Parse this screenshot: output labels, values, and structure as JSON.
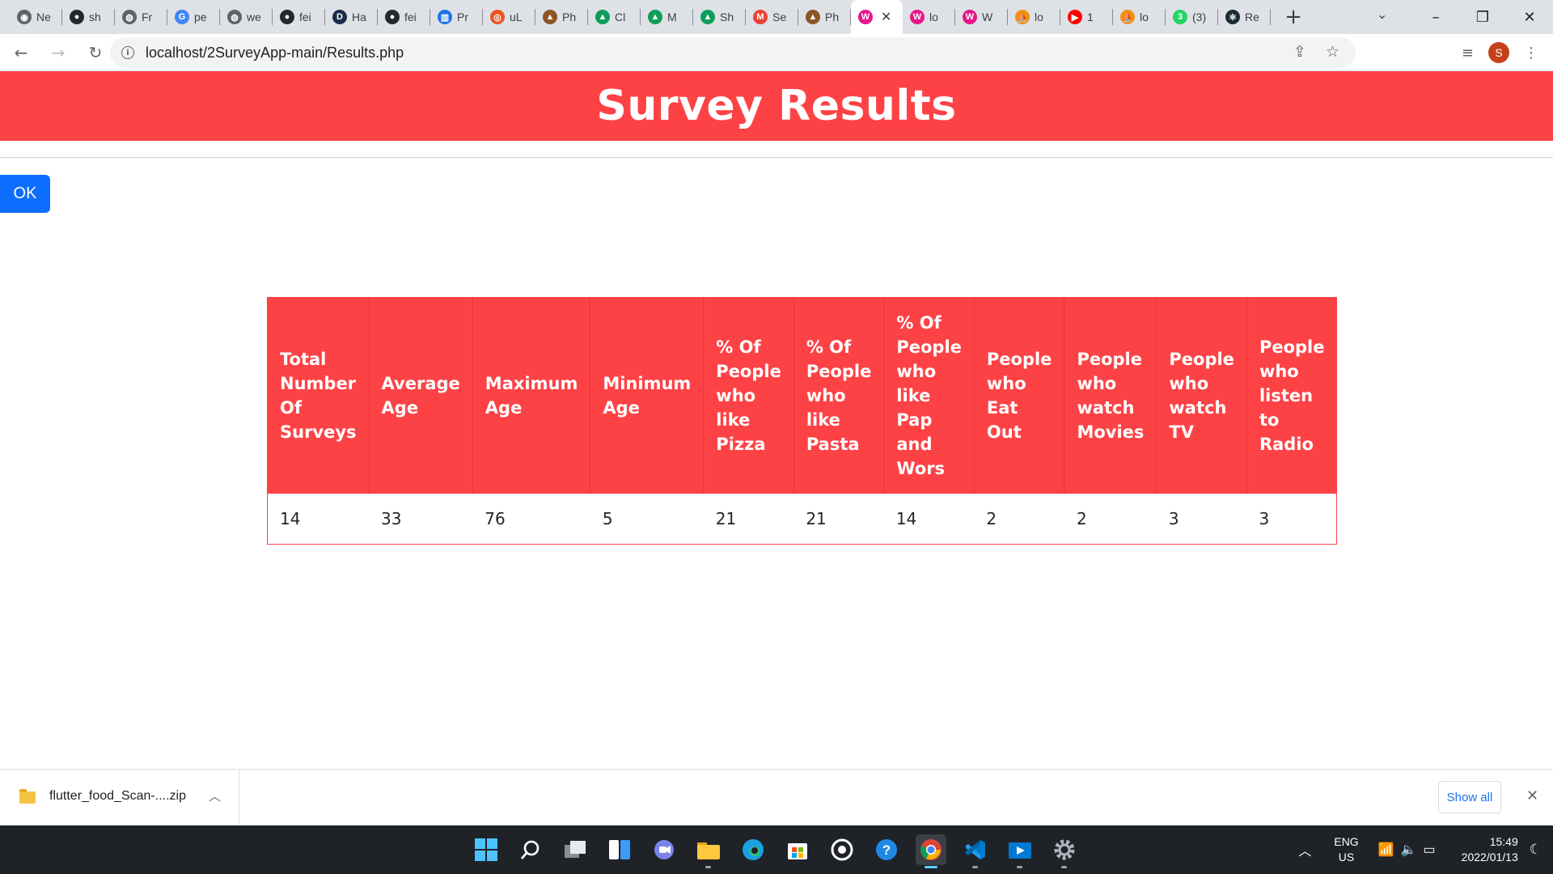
{
  "browser": {
    "tabs": [
      {
        "label": "Ne",
        "icon": "chrome-icon",
        "color": "#5f6368",
        "glyph": "◉"
      },
      {
        "label": "sh",
        "icon": "github-icon",
        "color": "#24292f",
        "glyph": "●"
      },
      {
        "label": "Fr",
        "icon": "globe-icon",
        "color": "#5f6368",
        "glyph": "◍"
      },
      {
        "label": "pe",
        "icon": "google-icon",
        "color": "#4285f4",
        "glyph": "G"
      },
      {
        "label": "we",
        "icon": "globe-icon",
        "color": "#5f6368",
        "glyph": "◍"
      },
      {
        "label": "fei",
        "icon": "github-icon",
        "color": "#24292f",
        "glyph": "●"
      },
      {
        "label": "Ha",
        "icon": "dev-icon",
        "color": "#1a2b4a",
        "glyph": "D"
      },
      {
        "label": "fei",
        "icon": "github-icon",
        "color": "#24292f",
        "glyph": "●"
      },
      {
        "label": "Pr",
        "icon": "board-icon",
        "color": "#1a73e8",
        "glyph": "▥"
      },
      {
        "label": "uL",
        "icon": "ubuntu-icon",
        "color": "#e95420",
        "glyph": "◎"
      },
      {
        "label": "Ph",
        "icon": "photo-icon",
        "color": "#8d5524",
        "glyph": "▲"
      },
      {
        "label": "Cl",
        "icon": "drive-icon",
        "color": "#0f9d58",
        "glyph": "▲"
      },
      {
        "label": "M",
        "icon": "drive-icon",
        "color": "#0f9d58",
        "glyph": "▲"
      },
      {
        "label": "Sh",
        "icon": "drive-icon",
        "color": "#0f9d58",
        "glyph": "▲"
      },
      {
        "label": "Se",
        "icon": "gmail-icon",
        "color": "#ea4335",
        "glyph": "M"
      },
      {
        "label": "Ph",
        "icon": "photo-icon",
        "color": "#8d5524",
        "glyph": "▲"
      },
      {
        "label": "",
        "icon": "wamp-icon",
        "color": "#e7168b",
        "glyph": "W",
        "active": true
      },
      {
        "label": "lo",
        "icon": "wamp-icon",
        "color": "#e7168b",
        "glyph": "W"
      },
      {
        "label": "W",
        "icon": "wamp-icon",
        "color": "#e7168b",
        "glyph": "W"
      },
      {
        "label": "lo",
        "icon": "phpmyadmin-icon",
        "color": "#f29111",
        "glyph": "⛵"
      },
      {
        "label": "1",
        "icon": "youtube-icon",
        "color": "#ff0000",
        "glyph": "▶"
      },
      {
        "label": "lo",
        "icon": "phpmyadmin-icon",
        "color": "#f29111",
        "glyph": "⛵"
      },
      {
        "label": "(3)",
        "icon": "whatsapp-icon",
        "color": "#25d366",
        "glyph": "3"
      },
      {
        "label": "Re",
        "icon": "react-icon",
        "color": "#1b2b34",
        "glyph": "⚛"
      }
    ],
    "url": "localhost/2SurveyApp-main/Results.php",
    "profile_initial": "S"
  },
  "page": {
    "heading": "Survey Results",
    "ok_button": "OK",
    "table": {
      "headers": [
        "Total Number Of Surveys",
        "Average Age",
        "Maximum Age",
        "Minimum Age",
        "% Of People who like Pizza",
        "% Of People who like Pasta",
        "% Of People who like Pap and Wors",
        "People who Eat Out",
        "People who watch Movies",
        "People who watch TV",
        "People who listen to Radio"
      ],
      "row": [
        "14",
        "33",
        "76",
        "5",
        "21",
        "21",
        "14",
        "2",
        "2",
        "3",
        "3"
      ]
    }
  },
  "downloads": {
    "file_name": "flutter_food_Scan-....zip",
    "show_all": "Show all"
  },
  "taskbar": {
    "lang_line1": "ENG",
    "lang_line2": "US",
    "time": "15:49",
    "date": "2022/01/13"
  },
  "colors": {
    "accent_red": "#fd4246",
    "button_blue": "#0d6efd"
  }
}
